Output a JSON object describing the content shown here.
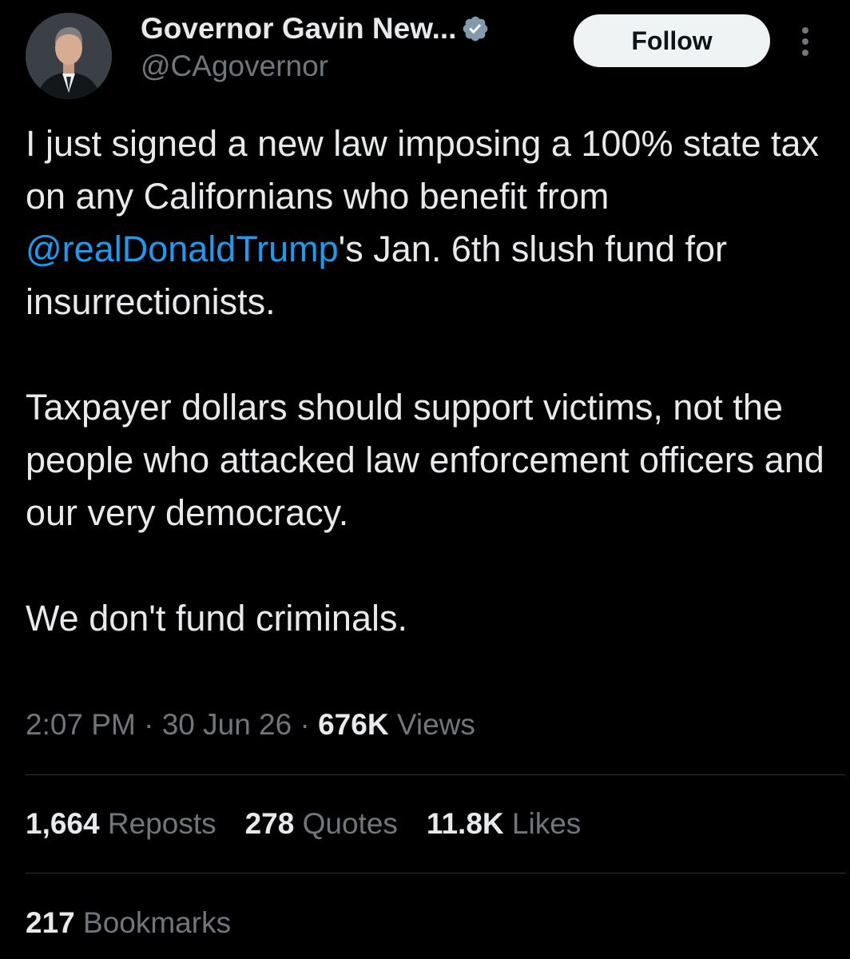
{
  "author": {
    "display_name": "Governor Gavin New...",
    "handle": "@CAgovernor",
    "verified_icon": "verified-badge-icon",
    "badge_color": "#829aab"
  },
  "actions": {
    "follow_label": "Follow",
    "more_icon": "more-vertical-icon"
  },
  "tweet": {
    "p1_before": "I just signed a new law imposing a 100% state tax on any Californians who benefit from ",
    "p1_mention": "@realDonaldTrump",
    "p1_after": "'s Jan. 6th slush fund for insurrectionists.",
    "p2": "Taxpayer dollars should support victims, not the people who attacked law enforcement officers and our very democracy.",
    "p3": "We don't fund criminals."
  },
  "meta": {
    "time": "2:07 PM",
    "sep": "·",
    "date": "30 Jun 26",
    "views_count": "676K",
    "views_label": "Views"
  },
  "stats": {
    "reposts_count": "1,664",
    "reposts_label": "Reposts",
    "quotes_count": "278",
    "quotes_label": "Quotes",
    "likes_count": "11.8K",
    "likes_label": "Likes",
    "bookmarks_count": "217",
    "bookmarks_label": "Bookmarks"
  },
  "colors": {
    "background": "#000000",
    "text": "#e7e9ea",
    "secondary_text": "#71767b",
    "link": "#1d9bf0",
    "divider": "#2f3336"
  }
}
